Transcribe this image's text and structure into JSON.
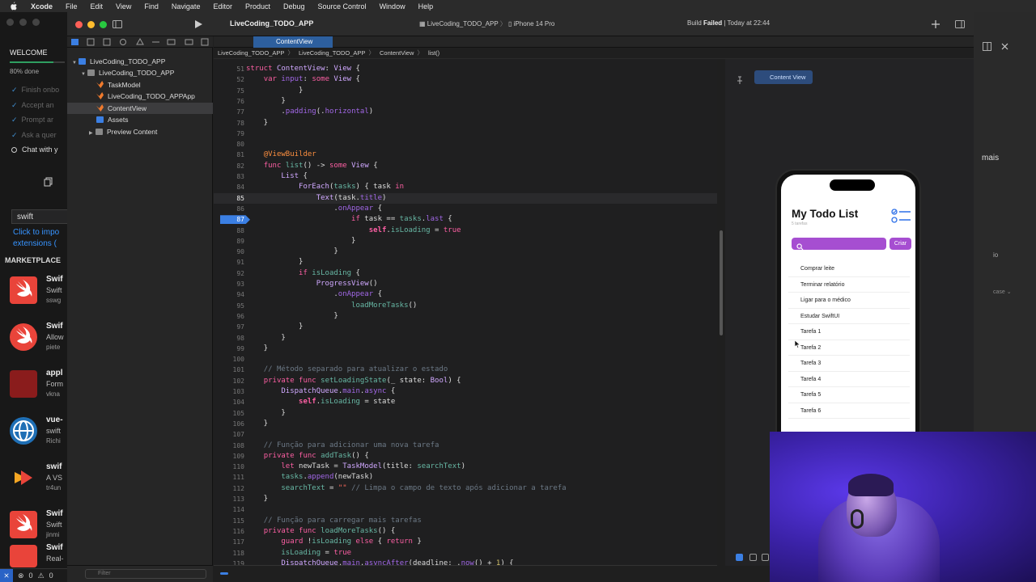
{
  "menubar": {
    "app": "Xcode",
    "items": [
      "File",
      "Edit",
      "View",
      "Find",
      "Navigate",
      "Editor",
      "Product",
      "Debug",
      "Source Control",
      "Window",
      "Help"
    ]
  },
  "vscode": {
    "welcome": "WELCOME",
    "done": "80% done",
    "steps": [
      "Finish onbo",
      "Accept an",
      "Prompt ar",
      "Ask a quer"
    ],
    "chat": "Chat with y",
    "search_value": "swift",
    "click_link": [
      "Click to impo",
      "extensions ("
    ],
    "marketplace": "MARKETPLACE",
    "extensions": [
      {
        "title": "Swif",
        "desc": "Swift",
        "publisher": "sswg"
      },
      {
        "title": "Swif",
        "desc": "Allow",
        "publisher": "piete"
      },
      {
        "title": "appl",
        "desc": "Form",
        "publisher": "vkna"
      },
      {
        "title": "vue-",
        "desc": "swift",
        "publisher": "Richi"
      },
      {
        "title": "swif",
        "desc": "A VS",
        "publisher": "tr4un"
      },
      {
        "title": "Swif",
        "desc": "Swift",
        "publisher": "jinmi"
      },
      {
        "title": "Swif",
        "desc": "Real-",
        "publisher": ""
      }
    ],
    "status_errors": "0",
    "status_warnings": "0"
  },
  "xcode": {
    "project_title": "LiveCoding_TODO_APP",
    "scheme": "LiveCoding_TODO_APP",
    "device": "iPhone 14 Pro",
    "build_status": "Build",
    "build_result": "Failed",
    "build_time": "| Today at 22:44",
    "active_tab": "ContentView",
    "breadcrumb": [
      "LiveCoding_TODO_APP",
      "LiveCoding_TODO_APP",
      "ContentView",
      "list()"
    ],
    "navigator": [
      {
        "label": "LiveCoding_TODO_APP",
        "indent": 0,
        "kind": "project",
        "open": true
      },
      {
        "label": "LiveCoding_TODO_APP",
        "indent": 1,
        "kind": "folder",
        "open": true
      },
      {
        "label": "TaskModel",
        "indent": 2,
        "kind": "swift"
      },
      {
        "label": "LiveCoding_TODO_APPApp",
        "indent": 2,
        "kind": "swift"
      },
      {
        "label": "ContentView",
        "indent": 2,
        "kind": "swift",
        "selected": true
      },
      {
        "label": "Assets",
        "indent": 2,
        "kind": "assets"
      },
      {
        "label": "Preview Content",
        "indent": 2,
        "kind": "folder",
        "open": false
      }
    ],
    "filter_placeholder": "Filter",
    "preview_label": "Content View",
    "code_lines": [
      {
        "n": "51",
        "h": "<span class='kw'>struct</span> <span class='ty'>ContentView</span>: <span class='ty'>View</span> {"
      },
      {
        "n": "52",
        "h": "    <span class='kw'>var</span> <span class='pr'>input</span>: <span class='kw'>some</span> <span class='ty'>View</span> {"
      },
      {
        "n": "75",
        "h": "            }"
      },
      {
        "n": "76",
        "h": "        }"
      },
      {
        "n": "77",
        "h": "        .<span class='pr'>padding</span>(.<span class='pr'>horizontal</span>)"
      },
      {
        "n": "78",
        "h": "    }"
      },
      {
        "n": "79",
        "h": ""
      },
      {
        "n": "80",
        "h": ""
      },
      {
        "n": "81",
        "h": "    <span class='at'>@ViewBuilder</span>"
      },
      {
        "n": "82",
        "h": "    <span class='kw'>func</span> <span class='fn'>list</span>() -> <span class='kw'>some</span> <span class='ty'>View</span> {"
      },
      {
        "n": "83",
        "h": "        <span class='ty'>List</span> {"
      },
      {
        "n": "84",
        "h": "            <span class='ty'>ForEach</span>(<span class='fn'>tasks</span>) { task <span class='kw'>in</span>"
      },
      {
        "n": "85",
        "h": "                <span class='ty'>Text</span>(task.<span class='pr'>title</span>)",
        "cur": true
      },
      {
        "n": "86",
        "h": "                    .<span class='pr'>onAppear</span> {"
      },
      {
        "n": "87",
        "h": "                        <span class='kw'>if</span> task == <span class='fn'>tasks</span>.<span class='pr'>last</span> {",
        "bp": true
      },
      {
        "n": "88",
        "h": "                            <span class='kw2'>self</span>.<span class='fn'>isLoading</span> = <span class='kw'>true</span>"
      },
      {
        "n": "89",
        "h": "                        }"
      },
      {
        "n": "90",
        "h": "                    }"
      },
      {
        "n": "91",
        "h": "            }"
      },
      {
        "n": "92",
        "h": "            <span class='kw'>if</span> <span class='fn'>isLoading</span> {"
      },
      {
        "n": "93",
        "h": "                <span class='ty'>ProgressView</span>()"
      },
      {
        "n": "94",
        "h": "                    .<span class='pr'>onAppear</span> {"
      },
      {
        "n": "95",
        "h": "                        <span class='fn'>loadMoreTasks</span>()"
      },
      {
        "n": "96",
        "h": "                    }"
      },
      {
        "n": "97",
        "h": "            }"
      },
      {
        "n": "98",
        "h": "        }"
      },
      {
        "n": "99",
        "h": "    }"
      },
      {
        "n": "100",
        "h": ""
      },
      {
        "n": "101",
        "h": "    <span class='cm'>// Método separado para atualizar o estado</span>"
      },
      {
        "n": "102",
        "h": "    <span class='kw'>private</span> <span class='kw'>func</span> <span class='fn'>setLoadingState</span>(_ state: <span class='ty'>Bool</span>) {"
      },
      {
        "n": "103",
        "h": "        <span class='ty'>DispatchQueue</span>.<span class='pr'>main</span>.<span class='pr'>async</span> {"
      },
      {
        "n": "104",
        "h": "            <span class='kw2'>self</span>.<span class='fn'>isLoading</span> = state"
      },
      {
        "n": "105",
        "h": "        }"
      },
      {
        "n": "106",
        "h": "    }"
      },
      {
        "n": "107",
        "h": ""
      },
      {
        "n": "108",
        "h": "    <span class='cm'>// Função para adicionar uma nova tarefa</span>"
      },
      {
        "n": "109",
        "h": "    <span class='kw'>private</span> <span class='kw'>func</span> <span class='fn'>addTask</span>() {"
      },
      {
        "n": "110",
        "h": "        <span class='kw'>let</span> newTask = <span class='ty'>TaskModel</span>(title: <span class='fn'>searchText</span>)"
      },
      {
        "n": "111",
        "h": "        <span class='fn'>tasks</span>.<span class='pr'>append</span>(newTask)"
      },
      {
        "n": "112",
        "h": "        <span class='fn'>searchText</span> = <span class='st'>\"\"</span> <span class='cm'>// Limpa o campo de texto após adicionar a tarefa</span>"
      },
      {
        "n": "113",
        "h": "    }"
      },
      {
        "n": "114",
        "h": ""
      },
      {
        "n": "115",
        "h": "    <span class='cm'>// Função para carregar mais tarefas</span>"
      },
      {
        "n": "116",
        "h": "    <span class='kw'>private</span> <span class='kw'>func</span> <span class='fn'>loadMoreTasks</span>() {"
      },
      {
        "n": "117",
        "h": "        <span class='kw'>guard</span> !<span class='fn'>isLoading</span> <span class='kw'>else</span> { <span class='kw'>return</span> }"
      },
      {
        "n": "118",
        "h": "        <span class='fn'>isLoading</span> = <span class='kw'>true</span>"
      },
      {
        "n": "119",
        "h": "        <span class='ty'>DispatchQueue</span>.<span class='pr'>main</span>.<span class='pr'>asyncAfter</span>(deadline: .<span class='pr'>now</span>() + <span class='nm'>1</span>) {"
      }
    ]
  },
  "preview": {
    "title": "My Todo List",
    "subtitle": "5 tarefas",
    "button": "Criar",
    "items": [
      "Comprar leite",
      "Terminar relatório",
      "Ligar para o médico",
      "Estudar SwiftUI",
      "Tarefa 1",
      "Tarefa 2",
      "Tarefa 3",
      "Tarefa 4",
      "Tarefa 5",
      "Tarefa 6"
    ]
  },
  "rightpanel": {
    "text1": "mais",
    "text2": "io",
    "text3": "case ⌄"
  },
  "colors": {
    "accent": "#3b7fe3",
    "purple": "#a64ed1",
    "vsc_blue": "#3794ff"
  }
}
